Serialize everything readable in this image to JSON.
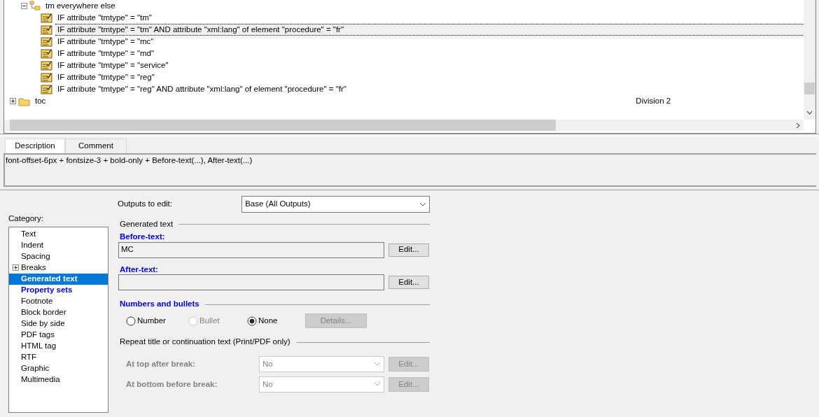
{
  "tree": {
    "nodes": [
      {
        "label": "tm everywhere else",
        "kind": "group",
        "expanded": true,
        "children": [
          {
            "label": "IF attribute \"tmtype\" = \"tm\"",
            "kind": "condition",
            "selected": false
          },
          {
            "label": "IF attribute \"tmtype\" = \"tm\" AND attribute \"xml:lang\" of element \"procedure\" = \"fr\"",
            "kind": "condition",
            "selected": true
          },
          {
            "label": "IF attribute \"tmtype\" = \"mc\"",
            "kind": "condition",
            "selected": false
          },
          {
            "label": "IF attribute \"tmtype\" = \"md\"",
            "kind": "condition",
            "selected": false
          },
          {
            "label": "IF attribute \"tmtype\" = \"service\"",
            "kind": "condition",
            "selected": false
          },
          {
            "label": "IF attribute \"tmtype\" = \"reg\"",
            "kind": "condition",
            "selected": false
          },
          {
            "label": "IF attribute \"tmtype\" = \"reg\" AND attribute \"xml:lang\" of element \"procedure\" = \"fr\"",
            "kind": "condition",
            "selected": false
          }
        ]
      },
      {
        "label": "toc",
        "kind": "folder",
        "expanded": false,
        "column_2": "Division 2"
      }
    ]
  },
  "tabs": [
    {
      "label": "Description",
      "selected": true
    },
    {
      "label": "Comment",
      "selected": false
    }
  ],
  "description": "font-offset-6px + fontsize-3 + bold-only + Before-text(...), After-text(...)",
  "category": {
    "label": "Category:",
    "items": [
      {
        "label": "Text",
        "selected": false,
        "emphasized": false
      },
      {
        "label": "Indent",
        "selected": false,
        "emphasized": false
      },
      {
        "label": "Spacing",
        "selected": false,
        "emphasized": false
      },
      {
        "label": "Breaks",
        "selected": false,
        "emphasized": false,
        "expanded": false
      },
      {
        "label": "Generated text",
        "selected": true,
        "emphasized": true
      },
      {
        "label": "Property sets",
        "selected": false,
        "emphasized": true
      },
      {
        "label": "Footnote",
        "selected": false,
        "emphasized": false
      },
      {
        "label": "Block border",
        "selected": false,
        "emphasized": false
      },
      {
        "label": "Side by side",
        "selected": false,
        "emphasized": false
      },
      {
        "label": "PDF tags",
        "selected": false,
        "emphasized": false
      },
      {
        "label": "HTML tag",
        "selected": false,
        "emphasized": false
      },
      {
        "label": "RTF",
        "selected": false,
        "emphasized": false
      },
      {
        "label": "Graphic",
        "selected": false,
        "emphasized": false
      },
      {
        "label": "Multimedia",
        "selected": false,
        "emphasized": false
      }
    ]
  },
  "outputs": {
    "label": "Outputs to edit:",
    "value": "Base (All Outputs)"
  },
  "generated_text": {
    "heading": "Generated text",
    "fields": [
      {
        "label": "Before-text:",
        "value": "MC",
        "button": "Edit..."
      },
      {
        "label": "After-text:",
        "button": "Edit..."
      }
    ]
  },
  "numbers": {
    "heading": "Numbers and bullets",
    "options": [
      {
        "label": "Number",
        "selected": false,
        "disabled": false
      },
      {
        "label": "Bullet",
        "selected": false,
        "disabled": true
      },
      {
        "label": "None",
        "selected": true,
        "disabled": false
      }
    ],
    "button": {
      "label": "Details...",
      "disabled": true
    }
  },
  "repeat": {
    "heading": "Repeat title or continuation text (Print/PDF only)",
    "rows": [
      {
        "label": "At top after break:",
        "value": "No",
        "button": "Edit...",
        "disabled": true
      },
      {
        "label": "At bottom before break:",
        "value": "No",
        "button": "Edit...",
        "disabled": true
      }
    ]
  }
}
